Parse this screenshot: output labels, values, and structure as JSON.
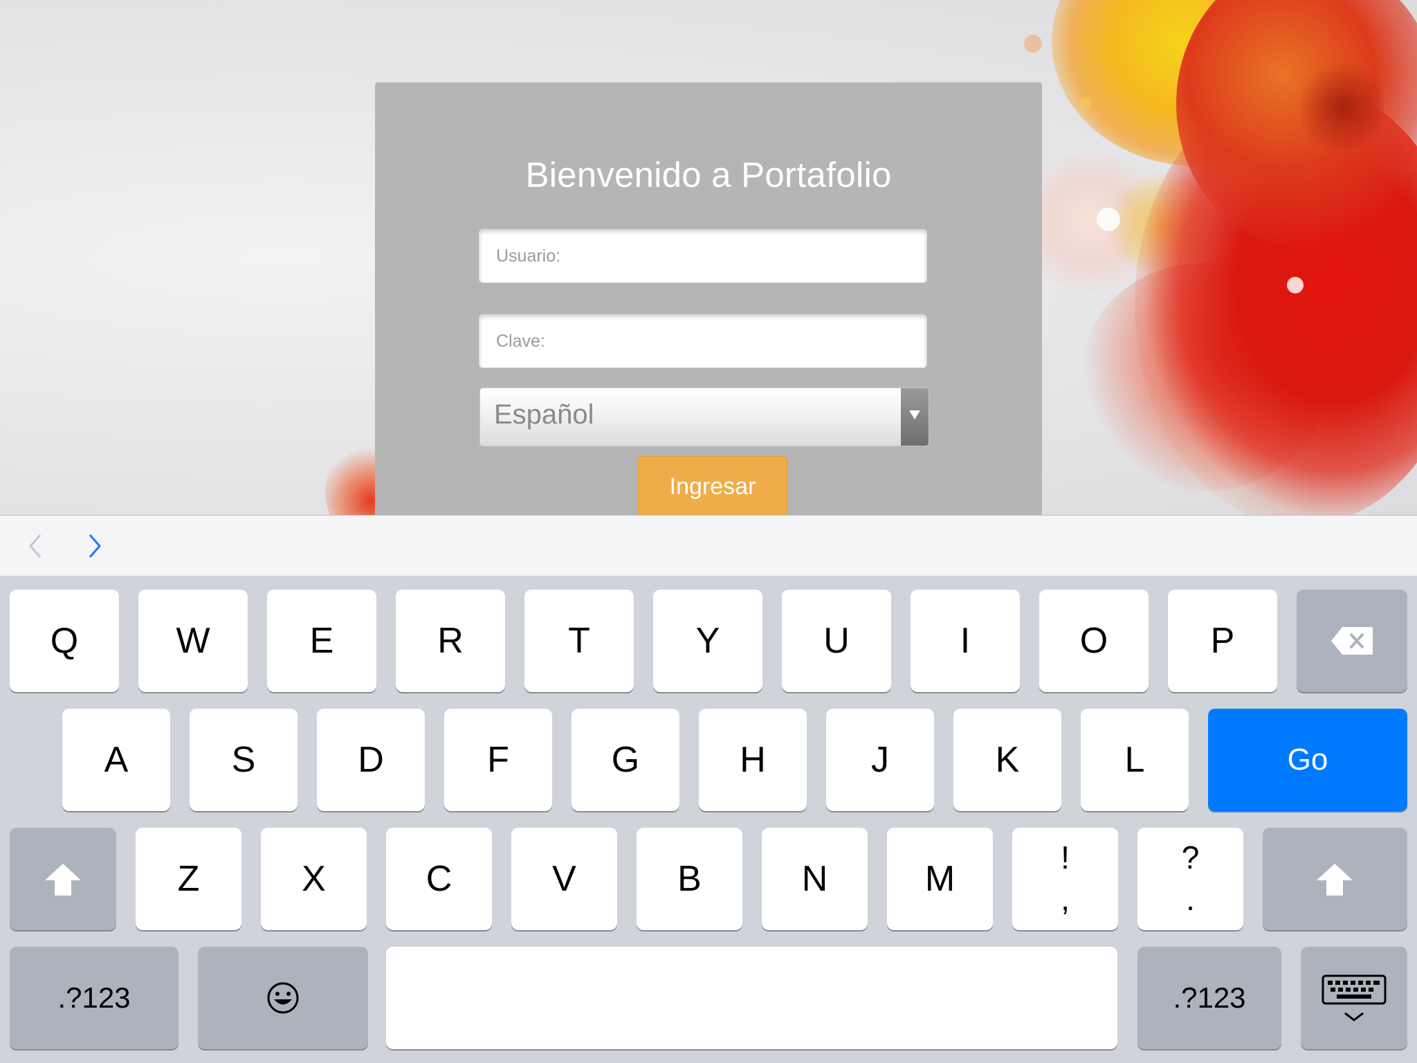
{
  "login": {
    "title": "Bienvenido a Portafolio",
    "username_placeholder": "Usuario:",
    "username_value": "",
    "password_placeholder": "Clave:",
    "password_value": "",
    "language_selected": "Español",
    "submit_label": "Ingresar"
  },
  "accessory_bar": {
    "previous_icon": "chevron-left-icon",
    "next_icon": "chevron-right-icon"
  },
  "keyboard": {
    "row1": [
      "Q",
      "W",
      "E",
      "R",
      "T",
      "Y",
      "U",
      "I",
      "O",
      "P"
    ],
    "row2": [
      "A",
      "S",
      "D",
      "F",
      "G",
      "H",
      "J",
      "K",
      "L"
    ],
    "row3": [
      "Z",
      "X",
      "C",
      "V",
      "B",
      "N",
      "M"
    ],
    "punct1": {
      "top": "!",
      "bottom": ","
    },
    "punct2": {
      "top": "?",
      "bottom": "."
    },
    "go_label": "Go",
    "numbers_label": ".?123",
    "icons": {
      "delete": "delete-icon",
      "shift": "shift-icon",
      "emoji": "emoji-icon",
      "dismiss": "keyboard-dismiss-icon"
    }
  },
  "colors": {
    "card": "#b5b5b5",
    "button": "#efad49",
    "go_key": "#007aff",
    "keyboard_bg": "#d0d3d9",
    "function_key": "#adb3bc"
  }
}
